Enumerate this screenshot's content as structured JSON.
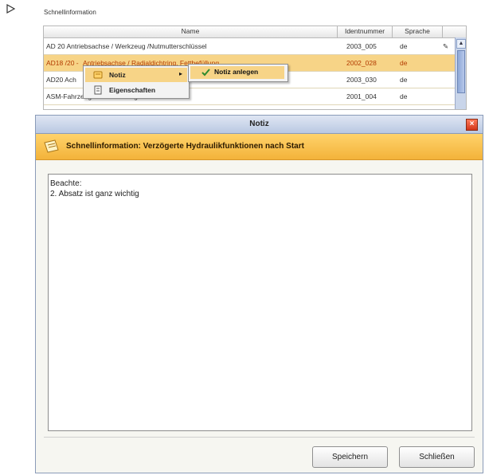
{
  "panel": {
    "title": "Schnellinformation",
    "columns": [
      "Name",
      "Identnummer",
      "Sprache"
    ],
    "rows": [
      {
        "name": "AD 20 Antriebsachse / Werkzeug /Nutmutterschlüssel",
        "id": "2003_005",
        "lang": "de"
      },
      {
        "name_prefix": "AD18 /20 - ",
        "name_link": "Antriebsachse / Radialdichtring, Fettbefüllung",
        "id": "2002_028",
        "lang": "de"
      },
      {
        "name": "AD20 Ach",
        "id": "2003_030",
        "lang": "de"
      },
      {
        "name": "ASM-Fahrzeuge: Vorbereitungen",
        "id": "2001_004",
        "lang": "de"
      }
    ]
  },
  "context_menu": {
    "items": [
      "Notiz",
      "Eigenschaften"
    ],
    "submenu": [
      "Notiz anlegen"
    ]
  },
  "dialog": {
    "title": "Notiz",
    "close": "×",
    "banner": "Schnellinformation: Verzögerte Hydraulikfunktionen nach Start",
    "text_line1": "Beachte:",
    "text_line2": "2. Absatz ist ganz wichtig",
    "save": "Speichern",
    "close_label": "Schließen"
  },
  "colors": {
    "highlight": "#f7d487",
    "banner": "#f3b33a",
    "titlebar": "#b9c8e2"
  }
}
